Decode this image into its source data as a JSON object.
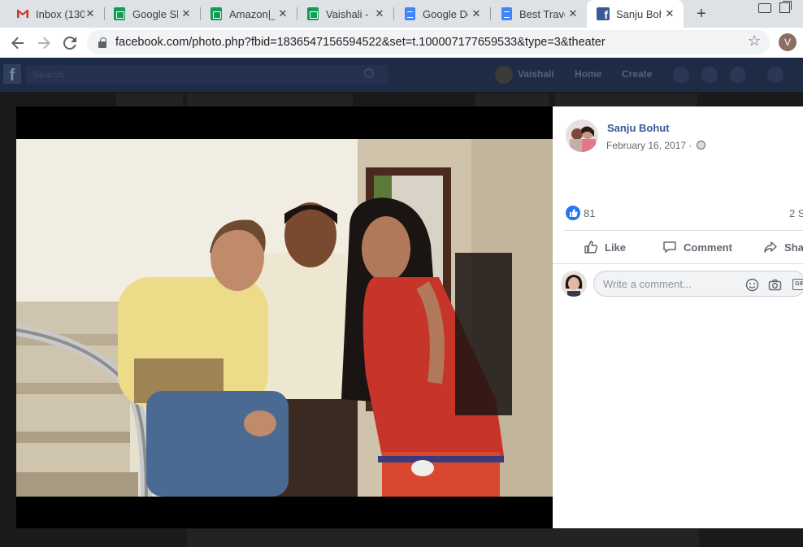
{
  "browser": {
    "tabs": [
      {
        "title": "Inbox (130",
        "icon": "gmail-icon",
        "active": false
      },
      {
        "title": "Google Sh",
        "icon": "google-sheets-icon",
        "active": false
      },
      {
        "title": "Amazon|_",
        "icon": "google-sheets-icon",
        "active": false
      },
      {
        "title": "Vaishali -",
        "icon": "google-sheets-icon",
        "active": false
      },
      {
        "title": "Google Do",
        "icon": "google-docs-icon",
        "active": false
      },
      {
        "title": "Best Trave",
        "icon": "google-docs-icon",
        "active": false
      },
      {
        "title": "Sanju Boh",
        "icon": "facebook-icon",
        "active": true
      }
    ],
    "tab_close": "✕",
    "new_tab": "+",
    "url": "facebook.com/photo.php?fbid=1836547156594522&set=t.100007177659533&type=3&theater",
    "profile_initial": "V"
  },
  "fb_header": {
    "search_placeholder": "Search",
    "user_name": "Vaishali",
    "home": "Home",
    "create": "Create"
  },
  "post": {
    "author": "Sanju Bohut",
    "date": "February 16, 2017 ·",
    "like_count": "81",
    "shares": "2 S",
    "actions": {
      "like": "Like",
      "comment": "Comment",
      "share": "Sha"
    },
    "comment_placeholder": "Write a comment...",
    "gif_label": "GIF"
  },
  "colors": {
    "fb_blue": "#385898",
    "like_blue": "#2078f4",
    "chrome_tabbar": "#dee1e6"
  }
}
